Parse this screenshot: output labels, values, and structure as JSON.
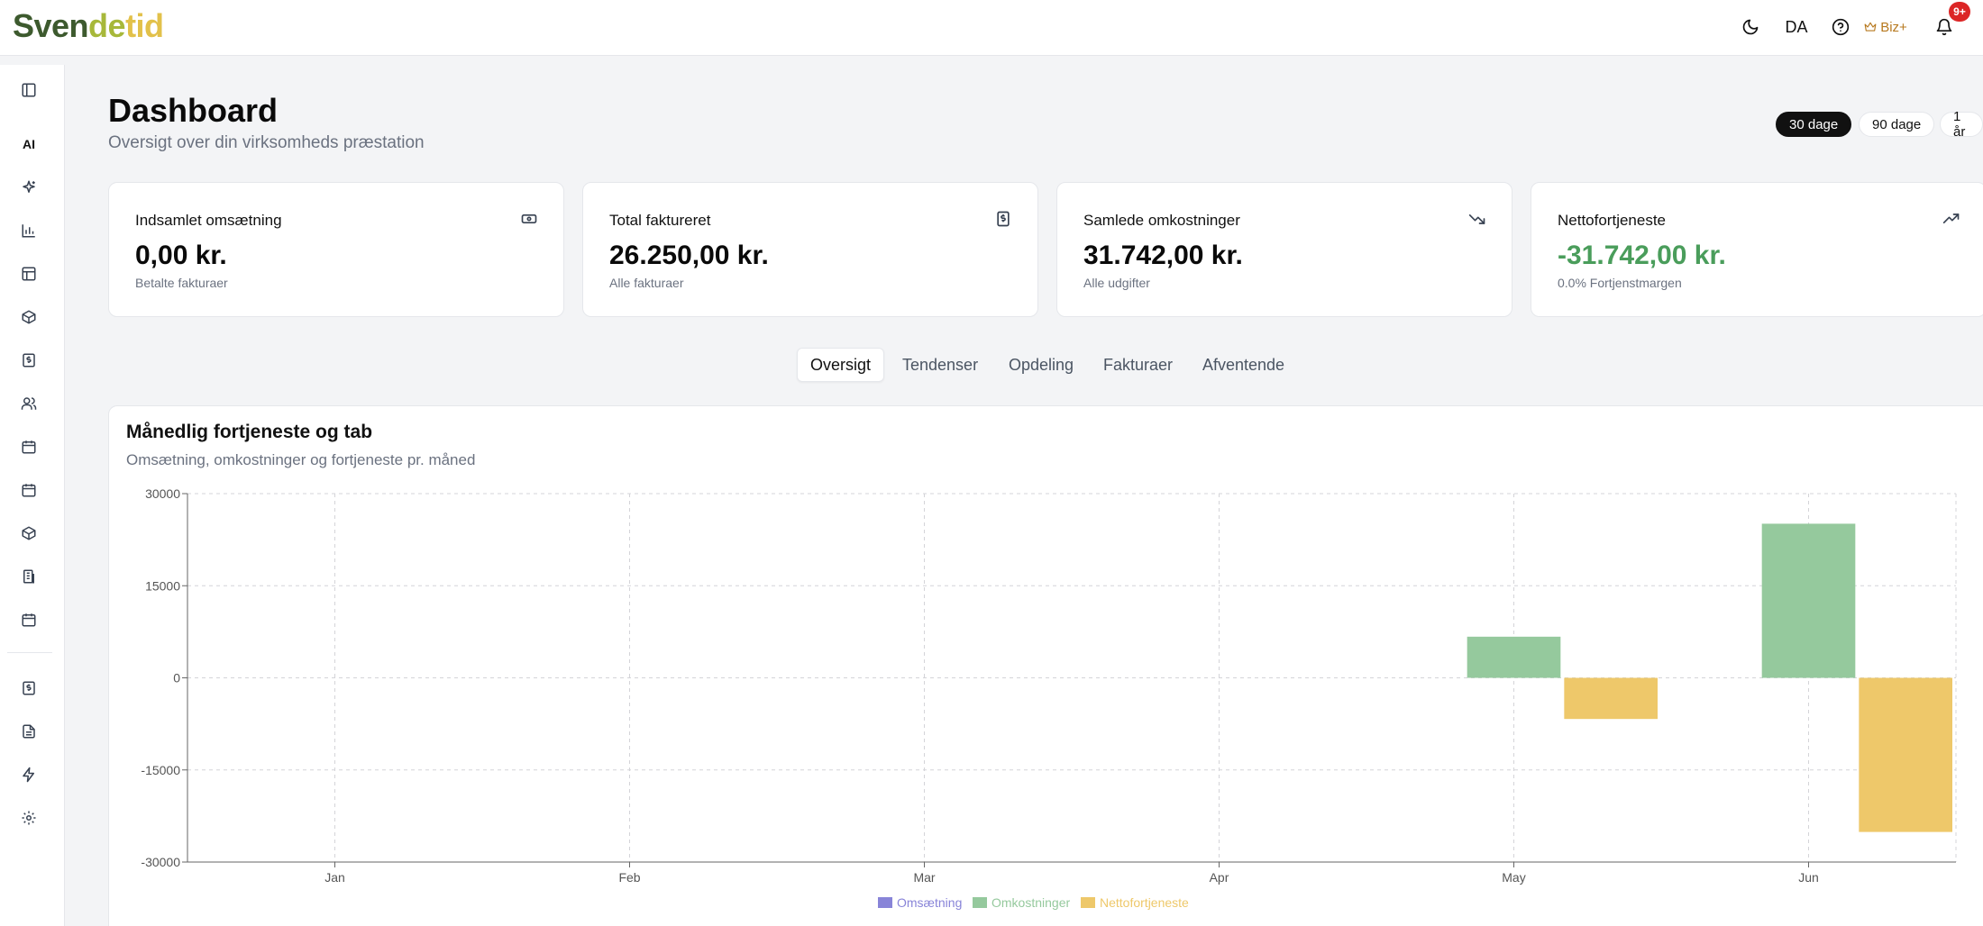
{
  "brand": {
    "part1": "Sven",
    "part2": "de",
    "part3": "tid"
  },
  "topbar": {
    "theme_icon": "moon-icon",
    "language": "DA",
    "help_icon": "help-circle-icon",
    "plan_label": "Biz+",
    "notifications_badge": "9+"
  },
  "sidebar": {
    "ai_label": "AI",
    "items": [
      "panel-toggle-icon",
      "sparkles-icon",
      "bar-chart-icon",
      "layout-icon",
      "package-icon",
      "invoice-icon",
      "users-icon",
      "calendar-icon",
      "calendar-icon",
      "package-icon",
      "building-icon",
      "calendar-icon",
      "invoice-icon",
      "file-text-icon",
      "zap-icon",
      "settings-icon"
    ]
  },
  "header": {
    "title": "Dashboard",
    "subtitle": "Oversigt over din virksomheds præstation",
    "ranges": [
      "30 dage",
      "90 dage",
      "1 år"
    ],
    "active_range": "30 dage"
  },
  "kpis": [
    {
      "label": "Indsamlet omsætning",
      "value": "0,00 kr.",
      "sub": "Betalte fakturaer",
      "icon": "banknote-icon"
    },
    {
      "label": "Total faktureret",
      "value": "26.250,00 kr.",
      "sub": "Alle fakturaer",
      "icon": "receipt-icon"
    },
    {
      "label": "Samlede omkostninger",
      "value": "31.742,00 kr.",
      "sub": "Alle udgifter",
      "icon": "trending-down-icon"
    },
    {
      "label": "Nettofortjeneste",
      "value": "-31.742,00 kr.",
      "sub": "0.0% Fortjenstmargen",
      "icon": "trending-up-icon"
    }
  ],
  "tabs": [
    "Oversigt",
    "Tendenser",
    "Opdeling",
    "Fakturaer",
    "Afventende"
  ],
  "active_tab": "Oversigt",
  "panel": {
    "title": "Månedlig fortjeneste og tab",
    "subtitle": "Omsætning, omkostninger og fortjeneste pr. måned"
  },
  "colors": {
    "omsaetning": "#8884d8",
    "omkostninger": "#95c99d",
    "nettofortjeneste": "#eec86a",
    "positive": "#4a9d5b"
  },
  "chart_data": {
    "type": "bar",
    "categories": [
      "Jan",
      "Feb",
      "Mar",
      "Apr",
      "May",
      "Jun"
    ],
    "series": [
      {
        "name": "Omsætning",
        "values": [
          0,
          0,
          0,
          0,
          0,
          0
        ]
      },
      {
        "name": "Omkostninger",
        "values": [
          0,
          0,
          0,
          0,
          6700,
          25100
        ]
      },
      {
        "name": "Nettofortjeneste",
        "values": [
          0,
          0,
          0,
          0,
          -6700,
          -25100
        ]
      }
    ],
    "yticks": [
      "30000",
      "15000",
      "0",
      "-15000",
      "-30000"
    ],
    "ylim": [
      -30000,
      30000
    ],
    "grid": true,
    "legend": "bottom-center"
  }
}
